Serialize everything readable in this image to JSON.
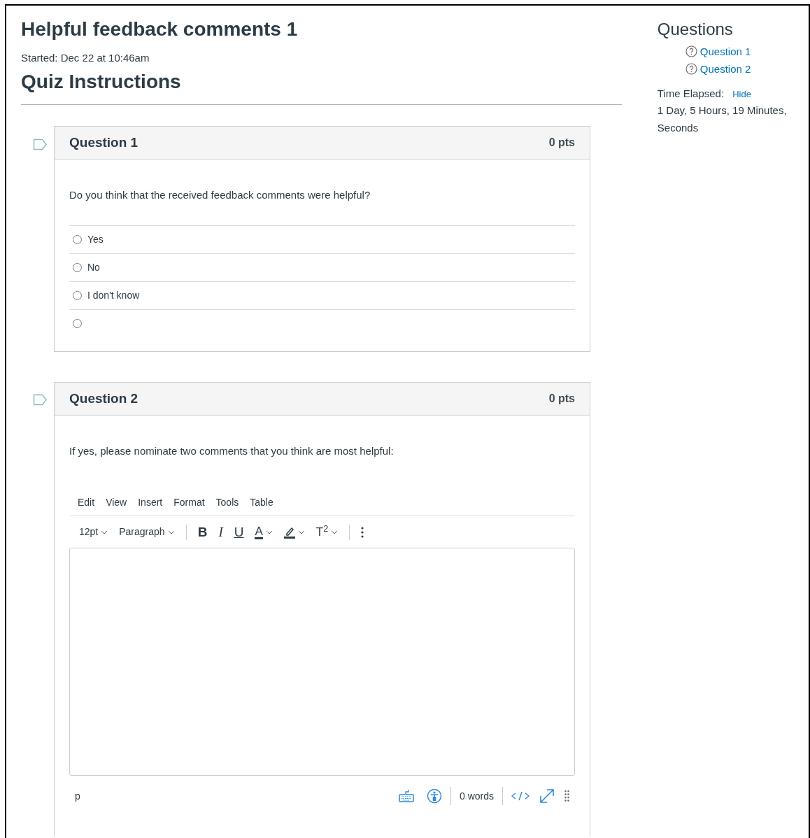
{
  "title": "Helpful feedback comments 1",
  "started": "Started: Dec 22 at 10:46am",
  "instructions_heading": "Quiz Instructions",
  "questions": [
    {
      "kind": "multiple_choice",
      "flagged": false,
      "title": "Question 1",
      "points": "0 pts",
      "text": "Do you think that the received feedback comments were helpful?",
      "answers": [
        {
          "label": "Yes",
          "selected": false
        },
        {
          "label": "No",
          "selected": false
        },
        {
          "label": "I don't know",
          "selected": false
        },
        {
          "selected": false
        }
      ]
    },
    {
      "kind": "essay",
      "flagged": false,
      "title": "Question 2",
      "points": "0 pts",
      "text": "If yes, please nominate two comments that you think are most helpful:",
      "editor": {
        "menu": [
          "Edit",
          "View",
          "Insert",
          "Format",
          "Tools",
          "Table"
        ],
        "toolbar": [
          {
            "kind": "dropdown",
            "label": "12pt"
          },
          {
            "kind": "dropdown",
            "label": "Paragraph"
          },
          {
            "kind": "separator"
          },
          {
            "kind": "bold",
            "label": "B"
          },
          {
            "kind": "italic",
            "label": "I"
          },
          {
            "kind": "underline",
            "label": "U"
          },
          {
            "kind": "text_color",
            "label": "A"
          },
          {
            "kind": "highlight"
          },
          {
            "kind": "superscript",
            "label": "T$^{2}$"
          },
          {
            "kind": "separator"
          },
          {
            "kind": "more"
          }
        ],
        "path": "p",
        "word_count": "0 words"
      }
    }
  ],
  "sidebar": {
    "heading": "Questions",
    "links": [
      {
        "label": "Question 1"
      },
      {
        "label": "Question 2"
      }
    ],
    "time_label": "Time Elapsed:",
    "hide": "Hide",
    "elapsed": [
      "1 Day, 5 Hours, 19 Minutes,",
      "Seconds"
    ]
  }
}
